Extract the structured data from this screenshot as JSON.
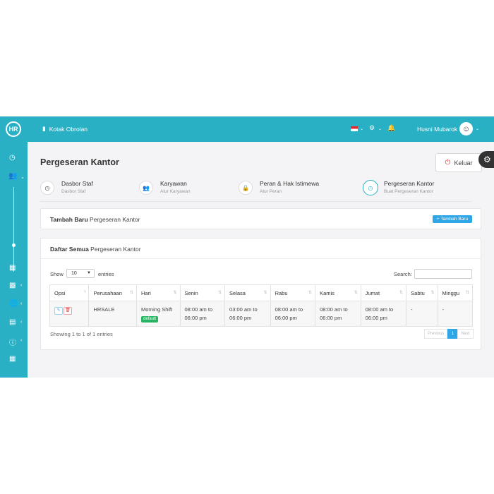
{
  "topbar": {
    "logo_text": "HR",
    "chat_label": "Kotak Obrolan",
    "user_name": "Husni Mubarok",
    "icons": [
      "chat-icon",
      "flag-icon",
      "gear-icon",
      "bell-icon",
      "avatar"
    ]
  },
  "sidebar": {
    "icons": [
      "dashboard-icon",
      "users-icon",
      "calculator-icon",
      "money-icon",
      "globe-icon",
      "building-icon",
      "info-icon",
      "calendar-icon"
    ]
  },
  "page": {
    "title": "Pergeseran Kantor",
    "logout_label": "Keluar"
  },
  "steps": [
    {
      "title": "Dasbor Staf",
      "subtitle": "Dasbor Staf"
    },
    {
      "title": "Karyawan",
      "subtitle": "Atur Karyawan"
    },
    {
      "title": "Peran & Hak Istimewa",
      "subtitle": "Atur Peran"
    },
    {
      "title": "Pergeseran Kantor",
      "subtitle": "Buat Pergeseran Kantor"
    }
  ],
  "add_card": {
    "title_bold": "Tambah Baru",
    "title_rest": " Pergeseran Kantor",
    "add_button": "+ Tambah Baru"
  },
  "list_card": {
    "title_bold": "Daftar Semua",
    "title_rest": " Pergeseran Kantor",
    "show_label": "Show",
    "entries_value": "10",
    "entries_label": "entries",
    "search_label": "Search:",
    "showing_text": "Showing 1 to 1 of 1 entries",
    "pager": {
      "prev": "Previous",
      "page": "1",
      "next": "Next"
    }
  },
  "table": {
    "headers": [
      "Opsi",
      "Perusahaan",
      "Hari",
      "Senin",
      "Selasa",
      "Rabu",
      "Kamis",
      "Jumat",
      "Sabtu",
      "Minggu"
    ],
    "rows": [
      {
        "company": "HRSALE",
        "shift": "Morning Shift",
        "badge": "default",
        "senin_a": "08:00 am to",
        "senin_b": "06:00 pm",
        "selasa_a": "03:00 am to",
        "selasa_b": "06:00 pm",
        "rabu_a": "08:00 am to",
        "rabu_b": "06:00 pm",
        "kamis_a": "08:00 am to",
        "kamis_b": "06:00 pm",
        "jumat_a": "08:00 am to",
        "jumat_b": "06:00 pm",
        "sabtu": "-",
        "minggu": "-"
      }
    ]
  }
}
